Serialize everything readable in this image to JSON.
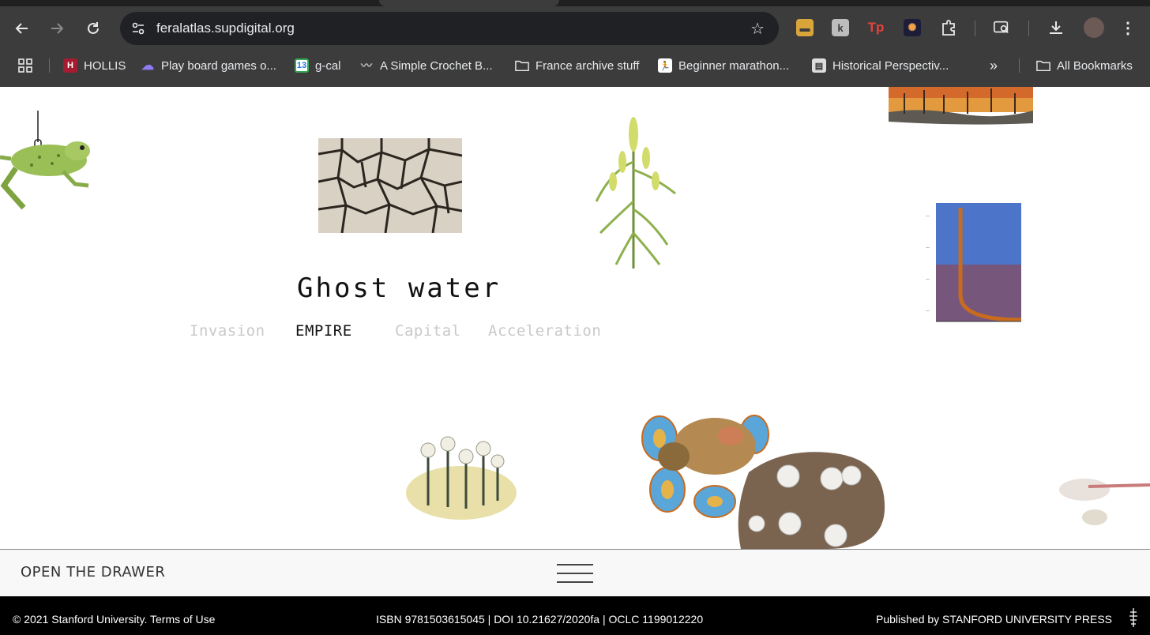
{
  "browser": {
    "url": "feralatlas.supdigital.org",
    "bookmarks": [
      {
        "label": "HOLLIS",
        "icon": "hollis-shield-icon"
      },
      {
        "label": "Play board games o...",
        "icon": "boardgame-icon"
      },
      {
        "label": "g-cal",
        "icon": "calendar-icon"
      },
      {
        "label": "A Simple Crochet B...",
        "icon": "crochet-icon"
      },
      {
        "label": "France archive stuff",
        "icon": "folder-icon"
      },
      {
        "label": "Beginner marathon...",
        "icon": "runner-icon"
      },
      {
        "label": "Historical Perspectiv...",
        "icon": "book-icon"
      }
    ],
    "all_bookmarks": "All Bookmarks",
    "calendar_day": "13",
    "ext_tp": "Tp",
    "ext_k": "k"
  },
  "page": {
    "title": "Ghost water",
    "tabs": [
      {
        "label": "Invasion",
        "active": false
      },
      {
        "label": "EMPIRE",
        "active": true
      },
      {
        "label": "Capital",
        "active": false
      },
      {
        "label": "Acceleration",
        "active": false
      }
    ],
    "illustrations": [
      "frog-illustration",
      "cracked-earth-illustration",
      "goldenrod-plant-illustration",
      "wildfire-landscape-illustration",
      "graph-painting-illustration",
      "dry-flowers-illustration",
      "beetle-illustration",
      "fungus-illustration",
      "larva-illustration"
    ]
  },
  "drawer": {
    "label": "OPEN THE DRAWER"
  },
  "footer": {
    "copyright": "© 2021 Stanford University. Terms of Use",
    "identifiers": "ISBN 9781503615045 | DOI 10.21627/2020fa | OCLC 1199012220",
    "publisher": "Published by STANFORD UNIVERSITY PRESS"
  },
  "colors": {
    "chrome": "#3c3c3c",
    "omnibox": "#202124",
    "tab_inactive": "#c9c9c9",
    "tab_active": "#111111",
    "footer": "#000000"
  }
}
